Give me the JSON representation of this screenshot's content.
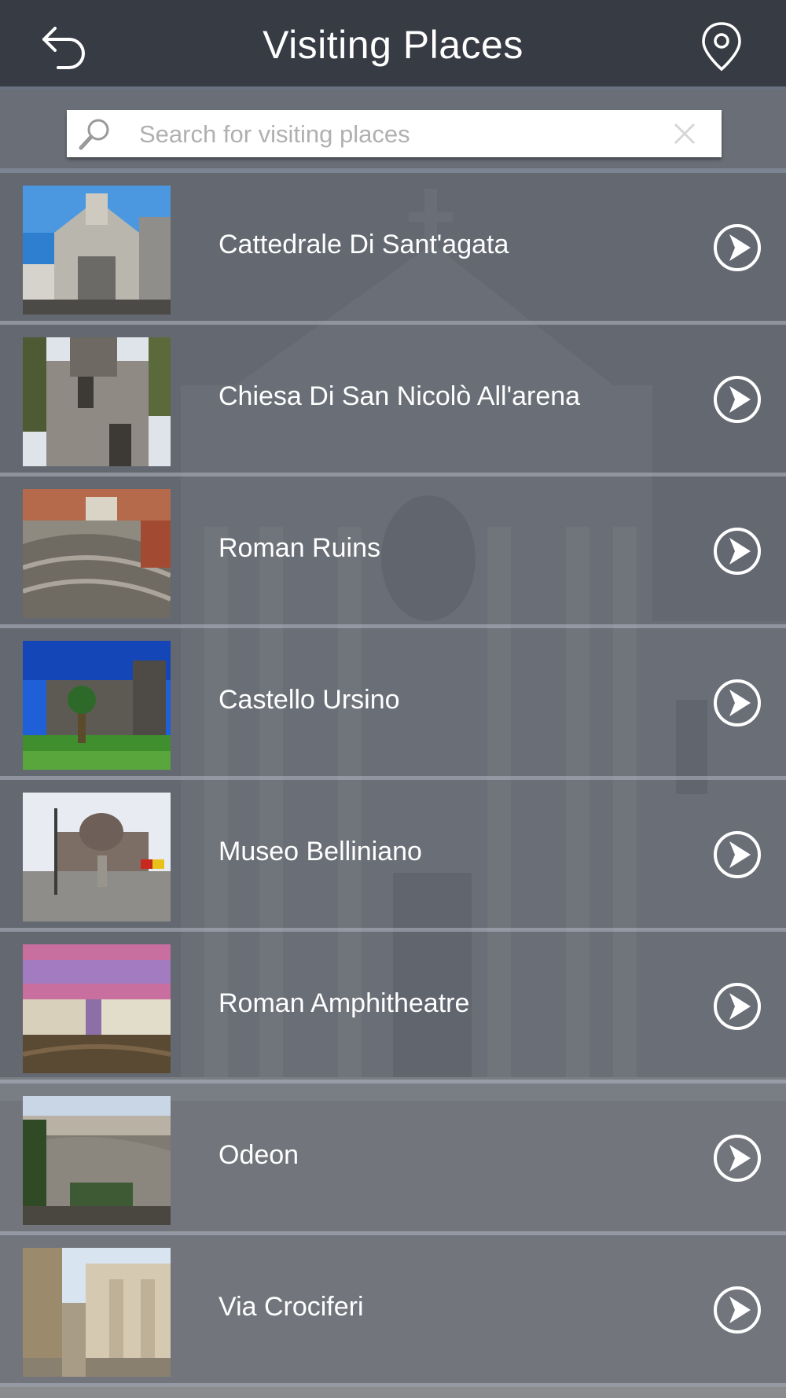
{
  "header": {
    "title": "Visiting Places",
    "back_icon": "back-arrow-icon",
    "map_icon": "map-pin-icon"
  },
  "search": {
    "placeholder": "Search for visiting places",
    "value": ""
  },
  "places": [
    {
      "name": "Cattedrale Di Sant'agata"
    },
    {
      "name": "Chiesa Di San Nicolò All'arena"
    },
    {
      "name": "Roman Ruins"
    },
    {
      "name": "Castello Ursino"
    },
    {
      "name": "Museo Belliniano"
    },
    {
      "name": "Roman Amphitheatre"
    },
    {
      "name": "Odeon"
    },
    {
      "name": "Via Crociferi"
    }
  ],
  "colors": {
    "header_bg": "#373b44",
    "row_overlay": "#5f6470",
    "text": "#ffffff"
  }
}
